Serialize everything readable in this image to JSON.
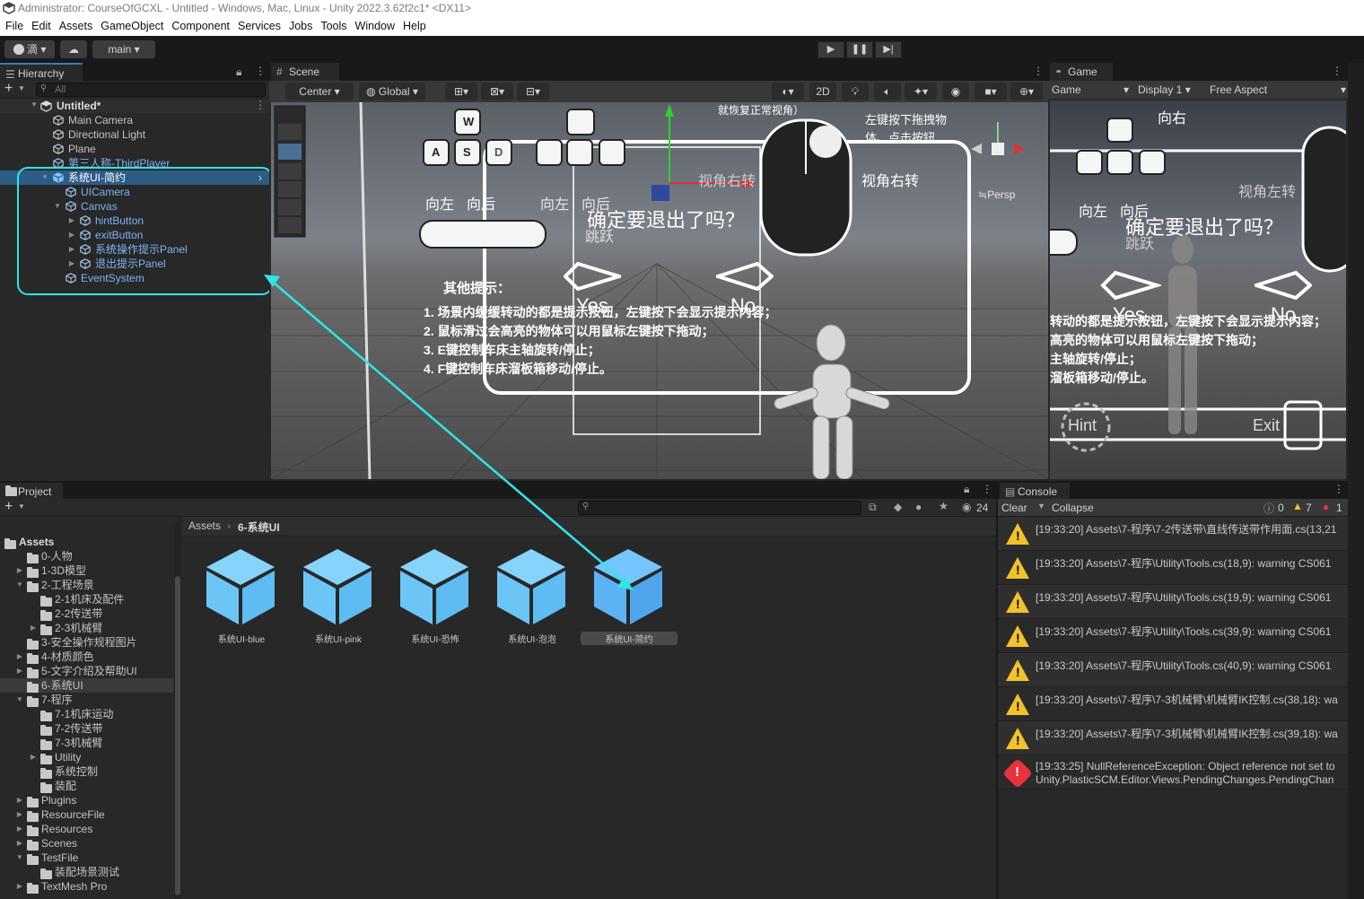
{
  "window": {
    "title": "Administrator: CourseOfGCXL - Untitled - Windows, Mac, Linux - Unity 2022.3.62f2c1* <DX11>"
  },
  "menu": [
    "File",
    "Edit",
    "Assets",
    "GameObject",
    "Component",
    "Services",
    "Jobs",
    "Tools",
    "Window",
    "Help"
  ],
  "toolbar": {
    "account": "滴",
    "branch": "main",
    "play": "▶",
    "pause": "❚❚",
    "step": "▶|"
  },
  "hierarchy": {
    "tab": "Hierarchy",
    "search_placeholder": "All",
    "scene": "Untitled*",
    "items": [
      {
        "label": "Main Camera",
        "indent": 1
      },
      {
        "label": "Directional Light",
        "indent": 1
      },
      {
        "label": "Plane",
        "indent": 1
      },
      {
        "label": "第三人称-ThirdPlayer",
        "indent": 1,
        "prefab": true
      },
      {
        "label": "系统UI-简约",
        "indent": 1,
        "prefab": true,
        "selected": true
      },
      {
        "label": "UICamera",
        "indent": 2,
        "prefab": true
      },
      {
        "label": "Canvas",
        "indent": 2,
        "prefab": true
      },
      {
        "label": "hintButton",
        "indent": 3,
        "prefab": true
      },
      {
        "label": "exitButton",
        "indent": 3,
        "prefab": true
      },
      {
        "label": "系统操作提示Panel",
        "indent": 3,
        "prefab": true
      },
      {
        "label": "退出提示Panel",
        "indent": 3,
        "prefab": true
      },
      {
        "label": "EventSystem",
        "indent": 2,
        "prefab": true
      }
    ]
  },
  "scene": {
    "tab": "Scene",
    "pivot": "Center",
    "space": "Global",
    "mode2d": "2D",
    "persp": "≒Persp",
    "overlay": {
      "keys": [
        "W",
        "A",
        "S",
        "D"
      ],
      "left_label": "向左",
      "back_label": "向后",
      "fwd_label": "向右",
      "jump_label": "跳跃",
      "drag_hint": "左键按下拖拽物体、点击按钮",
      "right_rotate": "视角右转",
      "reset_view": "就恢复正常视角）",
      "dialog": "确定要退出了吗？",
      "yes": "Yes",
      "no": "No",
      "tips_title": "其他提示：",
      "tips": [
        "1. 场景内缓缓转动的都是提示按钮，左键按下会显示提示内容；",
        "2. 鼠标滑过会高亮的物体可以用鼠标左键按下拖动；",
        "3. E键控制车床主轴旋转/停止；",
        "4. F键控制车床溜板箱移动/停止。"
      ]
    }
  },
  "game": {
    "tab": "Game",
    "mode": "Game",
    "display": "Display 1",
    "aspect": "Free Aspect",
    "dialog": "确定要退出了吗？",
    "yes": "Yes",
    "no": "No",
    "left_rotate": "视角左转",
    "hint": "Hint",
    "exit": "Exit",
    "tips": [
      "转动的都是提示按钮，左键按下会显示提示内容；",
      "高亮的物体可以用鼠标左键按下拖动；",
      "主轴旋转/停止；",
      "溜板箱移动/停止。"
    ]
  },
  "project": {
    "tab": "Project",
    "count": "24",
    "breadcrumb": [
      "Assets",
      "6-系统UI"
    ],
    "tree": [
      {
        "label": "Assets",
        "indent": 0,
        "open": true,
        "bold": true
      },
      {
        "label": "0-人物",
        "indent": 1
      },
      {
        "label": "1-3D模型",
        "indent": 1,
        "arrow": "▶"
      },
      {
        "label": "2-工程场景",
        "indent": 1,
        "arrow": "▼"
      },
      {
        "label": "2-1机床及配件",
        "indent": 2
      },
      {
        "label": "2-2传送带",
        "indent": 2
      },
      {
        "label": "2-3机械臂",
        "indent": 2,
        "arrow": "▶"
      },
      {
        "label": "3-安全操作规程图片",
        "indent": 1
      },
      {
        "label": "4-材质颜色",
        "indent": 1,
        "arrow": "▶"
      },
      {
        "label": "5-文字介绍及帮助UI",
        "indent": 1,
        "arrow": "▶"
      },
      {
        "label": "6-系统UI",
        "indent": 1,
        "selected": true
      },
      {
        "label": "7-程序",
        "indent": 1,
        "arrow": "▼"
      },
      {
        "label": "7-1机床运动",
        "indent": 2
      },
      {
        "label": "7-2传送带",
        "indent": 2
      },
      {
        "label": "7-3机械臂",
        "indent": 2
      },
      {
        "label": "Utility",
        "indent": 2,
        "arrow": "▶"
      },
      {
        "label": "系统控制",
        "indent": 2
      },
      {
        "label": "装配",
        "indent": 2
      },
      {
        "label": "Plugins",
        "indent": 1,
        "arrow": "▶"
      },
      {
        "label": "ResourceFile",
        "indent": 1,
        "arrow": "▶"
      },
      {
        "label": "Resources",
        "indent": 1,
        "arrow": "▶"
      },
      {
        "label": "Scenes",
        "indent": 1,
        "arrow": "▶"
      },
      {
        "label": "TestFile",
        "indent": 1,
        "arrow": "▼"
      },
      {
        "label": "装配场景测试",
        "indent": 2
      },
      {
        "label": "TextMesh Pro",
        "indent": 1,
        "arrow": "▶"
      }
    ],
    "assets": [
      "系统UI-blue",
      "系统UI-pink",
      "系统UI-恐怖",
      "系统UI-泡泡",
      "系统UI-简约"
    ]
  },
  "console": {
    "tab": "Console",
    "clear": "Clear",
    "collapse": "Collapse",
    "counts": {
      "log": "0",
      "warn": "7",
      "error": "1"
    },
    "rows": [
      {
        "type": "warn",
        "text": "[19:33:20] Assets\\7-程序\\7-2传送带\\直线传送带作用面.cs(13,21"
      },
      {
        "type": "warn",
        "text": "[19:33:20] Assets\\7-程序\\Utility\\Tools.cs(18,9): warning CS061"
      },
      {
        "type": "warn",
        "text": "[19:33:20] Assets\\7-程序\\Utility\\Tools.cs(19,9): warning CS061"
      },
      {
        "type": "warn",
        "text": "[19:33:20] Assets\\7-程序\\Utility\\Tools.cs(39,9): warning CS061"
      },
      {
        "type": "warn",
        "text": "[19:33:20] Assets\\7-程序\\Utility\\Tools.cs(40,9): warning CS061"
      },
      {
        "type": "warn",
        "text": "[19:33:20] Assets\\7-程序\\7-3机械臂\\机械臂IK控制.cs(38,18): wa"
      },
      {
        "type": "warn",
        "text": "[19:33:20] Assets\\7-程序\\7-3机械臂\\机械臂IK控制.cs(39,18): wa"
      },
      {
        "type": "error",
        "text": "[19:33:25] NullReferenceException: Object reference not set to",
        "text2": "Unity.PlasticSCM.Editor.Views.PendingChanges.PendingChan"
      }
    ]
  },
  "colors": {
    "accent_cyan": "#2ee6e6",
    "selection": "#2c5d87",
    "prefab_blue": "#7cb5f5"
  }
}
